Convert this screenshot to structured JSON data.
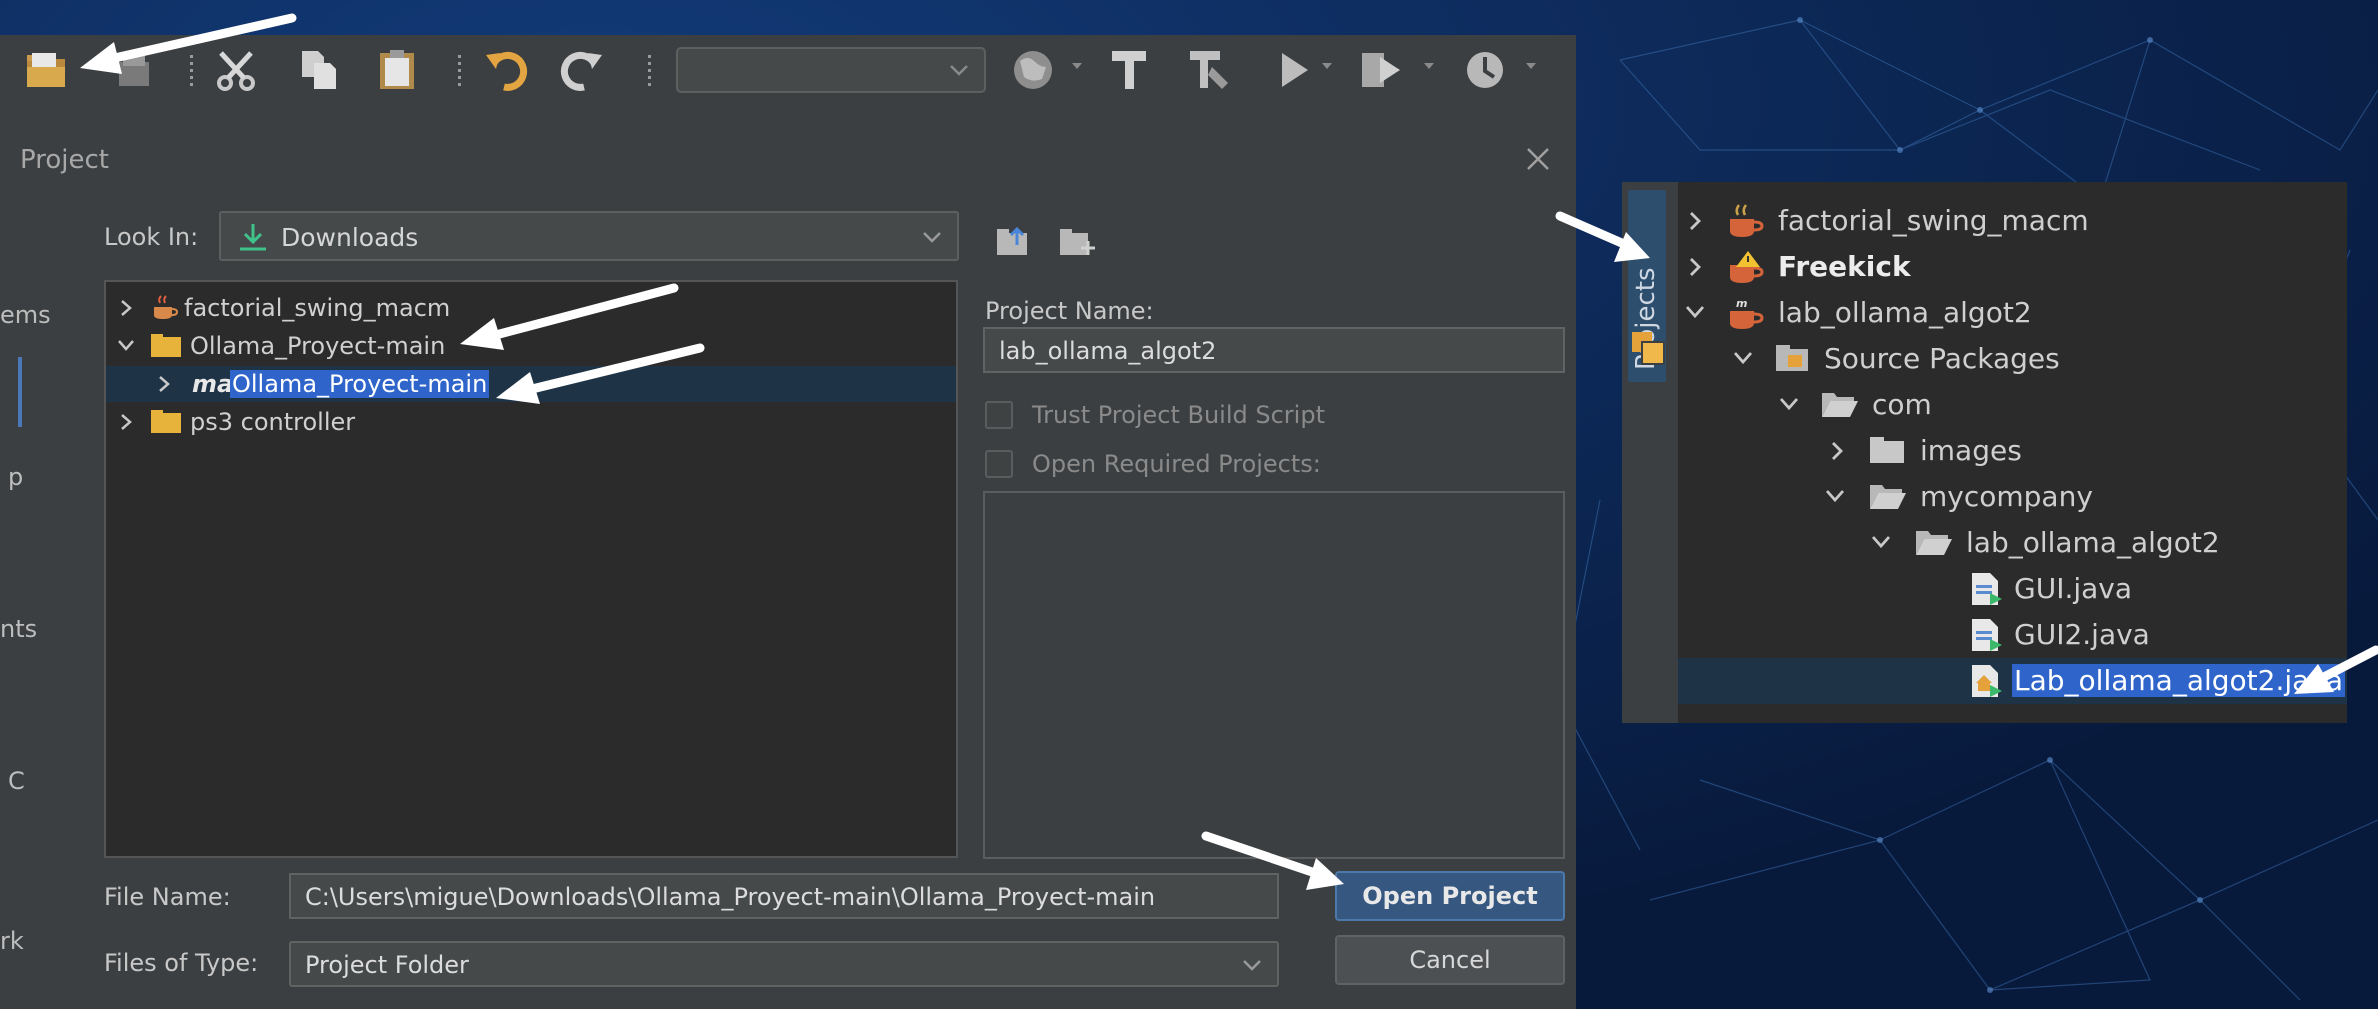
{
  "toolbar": {
    "config_combo_value": ""
  },
  "dialog": {
    "title": "Project",
    "sidebar_stub_labels": [
      "ems",
      "p",
      "nts",
      "C",
      "rk"
    ],
    "look_in_label": "Look In:",
    "look_in_value": "Downloads",
    "file_tree": [
      {
        "name": "factorial_swing_macm",
        "expanded": false
      },
      {
        "name": "Ollama_Proyect-main",
        "expanded": true
      },
      {
        "prefix": "ma",
        "name": "Ollama_Proyect-main",
        "expanded": false,
        "selected": true
      },
      {
        "name": "ps3 controller",
        "expanded": false
      }
    ],
    "project_name_label": "Project Name:",
    "project_name_value": "lab_ollama_algot2",
    "trust_build_script_label": "Trust Project Build Script",
    "open_required_label": "Open Required Projects:",
    "file_name_label": "File Name:",
    "file_name_value": "C:\\Users\\migue\\Downloads\\Ollama_Proyect-main\\Ollama_Proyect-main",
    "files_of_type_label": "Files of Type:",
    "files_of_type_value": "Project Folder",
    "open_button": "Open Project",
    "cancel_button": "Cancel"
  },
  "projects_panel": {
    "tab_label": "Projects",
    "tree": [
      {
        "name": "factorial_swing_macm",
        "level": 0,
        "expanded": false,
        "icon": "coffee-cup-project-icon"
      },
      {
        "name": "Freekick",
        "level": 0,
        "expanded": false,
        "icon": "coffee-cup-warning-icon",
        "bold": true
      },
      {
        "name": "lab_ollama_algot2",
        "level": 0,
        "expanded": true,
        "icon": "maven-project-icon"
      },
      {
        "name": "Source Packages",
        "level": 1,
        "expanded": true,
        "icon": "source-packages-icon"
      },
      {
        "name": "com",
        "level": 2,
        "expanded": true,
        "icon": "open-folder-icon"
      },
      {
        "name": "images",
        "level": 3,
        "expanded": false,
        "icon": "folder-icon"
      },
      {
        "name": "mycompany",
        "level": 3,
        "expanded": true,
        "icon": "open-folder-icon"
      },
      {
        "name": "lab_ollama_algot2",
        "level": 4,
        "expanded": true,
        "icon": "open-folder-icon"
      },
      {
        "name": "GUI.java",
        "level": 5,
        "icon": "java-form-file-icon"
      },
      {
        "name": "GUI2.java",
        "level": 5,
        "icon": "java-form-file-icon"
      },
      {
        "name": "Lab_ollama_algot2.java",
        "level": 5,
        "icon": "java-main-file-icon",
        "selected": true
      }
    ]
  },
  "colors": {
    "background": "#0c2450",
    "panel": "#3c3f41",
    "tree_bg": "#2b2b2b",
    "selection": "#2f65ca",
    "primary_button": "#365880"
  }
}
